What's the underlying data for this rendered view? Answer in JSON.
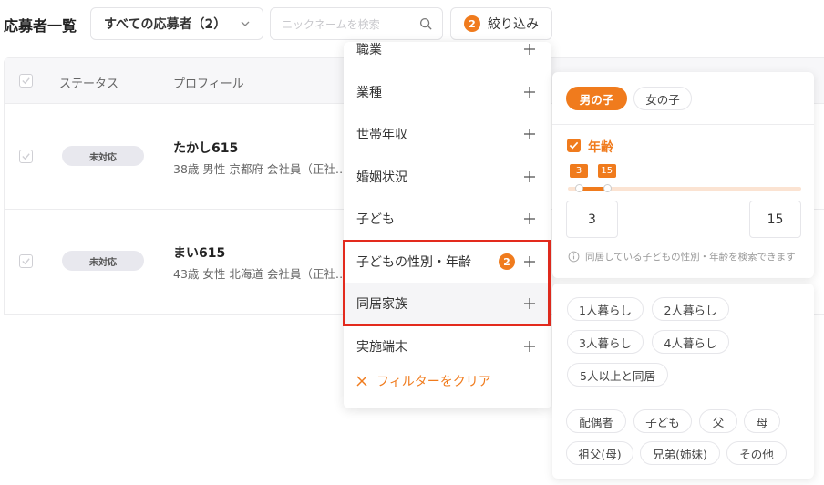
{
  "header": {
    "page_title": "応募者一覧",
    "applicant_select": "すべての応募者（2）",
    "search_placeholder": "ニックネームを検索",
    "filter_button_label": "絞り込み",
    "filter_count": "2"
  },
  "table": {
    "columns": {
      "status": "ステータス",
      "profile": "プロフィール"
    },
    "rows": [
      {
        "status": "未対応",
        "name": "たかし615",
        "detail": "38歳 男性 京都府 会社員（正社…"
      },
      {
        "status": "未対応",
        "name": "まい615",
        "detail": "43歳 女性 北海道 会社員（正社…"
      }
    ]
  },
  "filter_menu": {
    "items": [
      {
        "label": "職業"
      },
      {
        "label": "業種"
      },
      {
        "label": "世帯年収"
      },
      {
        "label": "婚姻状況"
      },
      {
        "label": "子ども"
      },
      {
        "label": "子どもの性別・年齢",
        "badge": "2"
      },
      {
        "label": "同居家族"
      },
      {
        "label": "実施端末"
      }
    ],
    "clear_label": "フィルターをクリア"
  },
  "child_filter_panel": {
    "gender_chips": [
      "男の子",
      "女の子"
    ],
    "selected_gender": "男の子",
    "age_label": "年齢",
    "age_checked": true,
    "age_min": "3",
    "age_max": "15",
    "age_range_fraction": [
      0.0,
      0.12
    ],
    "hint": "同居している子どもの性別・年齢を検索できます"
  },
  "household_panel": {
    "household_chips": [
      "1人暮らし",
      "2人暮らし",
      "3人暮らし",
      "4人暮らし",
      "5人以上と同居"
    ],
    "member_chips": [
      "配偶者",
      "子ども",
      "父",
      "母",
      "祖父(母)",
      "兄弟(姉妹)",
      "その他"
    ]
  },
  "colors": {
    "accent": "#f07b1d",
    "highlight": "#e32a1d",
    "status_badge_bg": "#e8e8ee"
  }
}
